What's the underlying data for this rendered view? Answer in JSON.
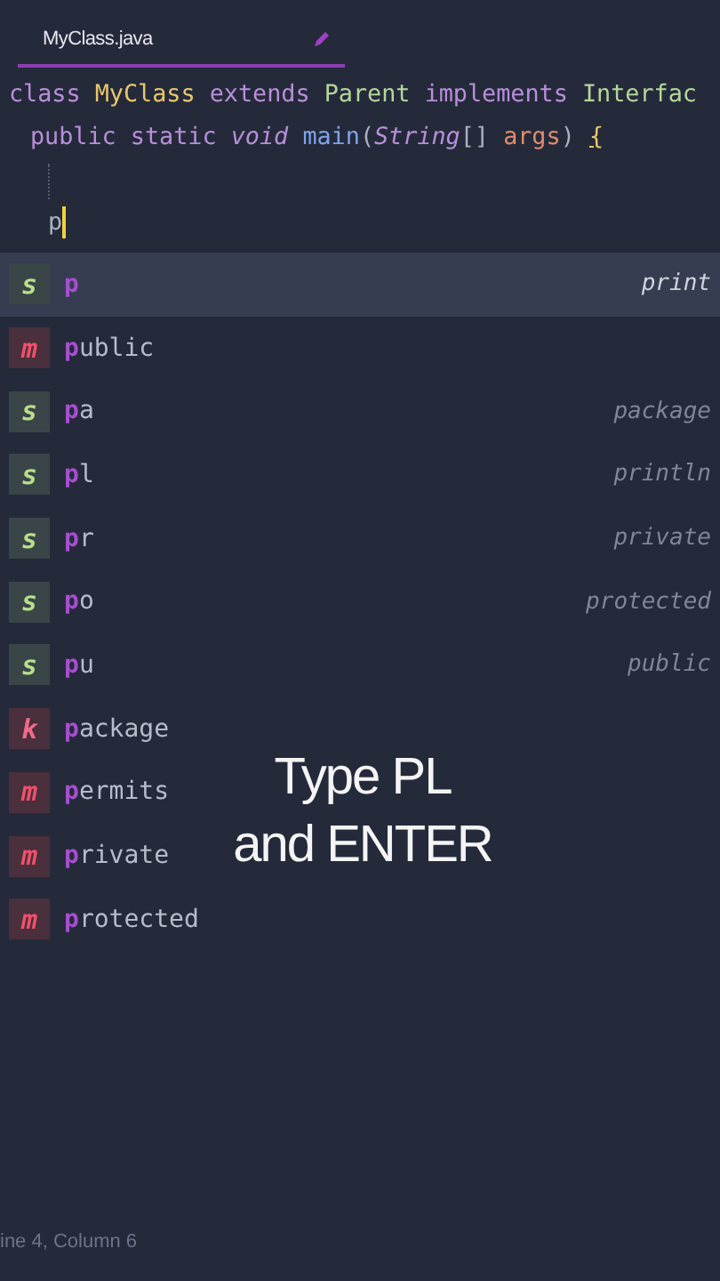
{
  "tab": {
    "title": "MyClass.java",
    "modified": true
  },
  "code_lines": [
    {
      "tokens": [
        {
          "kind": "keyword",
          "text": "class "
        },
        {
          "kind": "type",
          "text": "MyClass "
        },
        {
          "kind": "keyword",
          "text": "extends "
        },
        {
          "kind": "parent",
          "text": "Parent "
        },
        {
          "kind": "keyword",
          "text": "implements "
        },
        {
          "kind": "parent",
          "text": "Interfac"
        }
      ]
    },
    {
      "tokens": [
        {
          "kind": "keyword",
          "text": "public static "
        },
        {
          "kind": "italic",
          "text": "void "
        },
        {
          "kind": "function",
          "text": "main"
        },
        {
          "kind": "plain",
          "text": "("
        },
        {
          "kind": "italic",
          "text": "String"
        },
        {
          "kind": "plain",
          "text": "[] "
        },
        {
          "kind": "param",
          "text": "args"
        },
        {
          "kind": "plain",
          "text": ") "
        },
        {
          "kind": "brace",
          "text": "{"
        }
      ]
    },
    {
      "blank": true
    },
    {
      "tokens": [
        {
          "kind": "plain",
          "text": "p"
        }
      ],
      "cursor": true
    }
  ],
  "suggestions": [
    {
      "kind": "s",
      "badge": "s",
      "match": "p",
      "detail": "print",
      "selected": true
    },
    {
      "kind": "m",
      "badge": "m",
      "match": "p",
      "rest": "ublic",
      "selected": false
    },
    {
      "kind": "s",
      "badge": "s",
      "match": "p",
      "rest": "a",
      "detail": "package",
      "selected": false
    },
    {
      "kind": "s",
      "badge": "s",
      "match": "p",
      "rest": "l",
      "detail": "println",
      "selected": false
    },
    {
      "kind": "s",
      "badge": "s",
      "match": "p",
      "rest": "r",
      "detail": "private",
      "selected": false
    },
    {
      "kind": "s",
      "badge": "s",
      "match": "p",
      "rest": "o",
      "detail": "protected",
      "selected": false
    },
    {
      "kind": "s",
      "badge": "s",
      "match": "p",
      "rest": "u",
      "detail": "public",
      "selected": false
    },
    {
      "kind": "k",
      "badge": "k",
      "match": "p",
      "rest": "ackage",
      "selected": false
    },
    {
      "kind": "m",
      "badge": "m",
      "match": "p",
      "rest": "ermits",
      "selected": false
    },
    {
      "kind": "m",
      "badge": "m",
      "match": "p",
      "rest": "rivate",
      "selected": false
    },
    {
      "kind": "m",
      "badge": "m",
      "match": "p",
      "rest": "rotected",
      "selected": false
    }
  ],
  "caption": [
    "Type PL",
    "and ENTER"
  ],
  "status_bar": "ine 4, Column 6"
}
